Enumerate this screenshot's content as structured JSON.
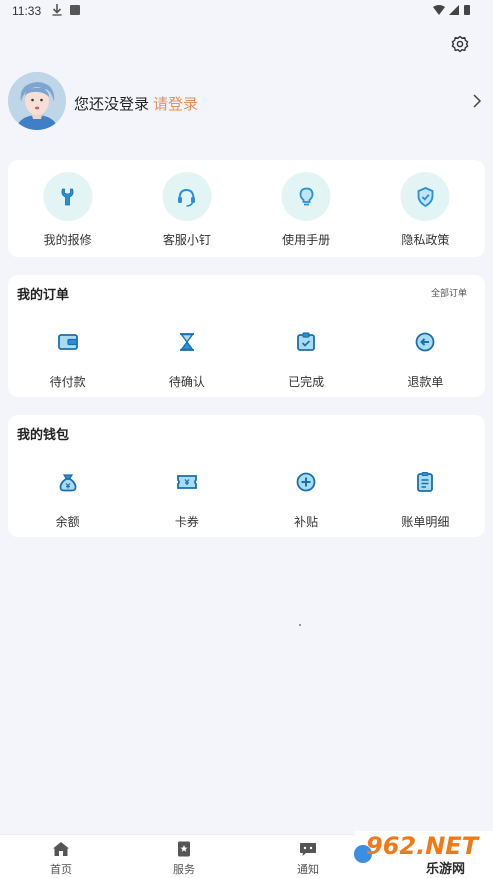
{
  "status_bar": {
    "time": "11:33"
  },
  "profile": {
    "not_logged": "您还没登录",
    "login_link": "请登录"
  },
  "tools": [
    {
      "label": "我的报修",
      "icon": "wrench-icon"
    },
    {
      "label": "客服小钉",
      "icon": "headset-icon"
    },
    {
      "label": "使用手册",
      "icon": "lightbulb-icon"
    },
    {
      "label": "隐私政策",
      "icon": "shield-check-icon"
    }
  ],
  "orders": {
    "title": "我的订单",
    "more": "全部订单",
    "items": [
      {
        "label": "待付款",
        "icon": "wallet-icon"
      },
      {
        "label": "待确认",
        "icon": "hourglass-icon"
      },
      {
        "label": "已完成",
        "icon": "clipboard-check-icon"
      },
      {
        "label": "退款单",
        "icon": "refund-icon"
      }
    ]
  },
  "wallet": {
    "title": "我的钱包",
    "items": [
      {
        "label": "余额",
        "icon": "money-bag-icon"
      },
      {
        "label": "卡券",
        "icon": "ticket-icon"
      },
      {
        "label": "补贴",
        "icon": "subsidy-icon"
      },
      {
        "label": "账单明细",
        "icon": "bill-icon"
      }
    ]
  },
  "bottom_nav": [
    {
      "label": "首页",
      "icon": "home-icon"
    },
    {
      "label": "服务",
      "icon": "service-icon"
    },
    {
      "label": "通知",
      "icon": "notification-icon"
    }
  ],
  "watermark": {
    "brand": "962.NET",
    "text": "乐游网"
  },
  "colors": {
    "accent": "#2a8fd6",
    "login_link": "#e68f5a",
    "tool_circle": "#e3f4f4",
    "background": "#f4f5fa",
    "watermark": "#f07a1a"
  }
}
